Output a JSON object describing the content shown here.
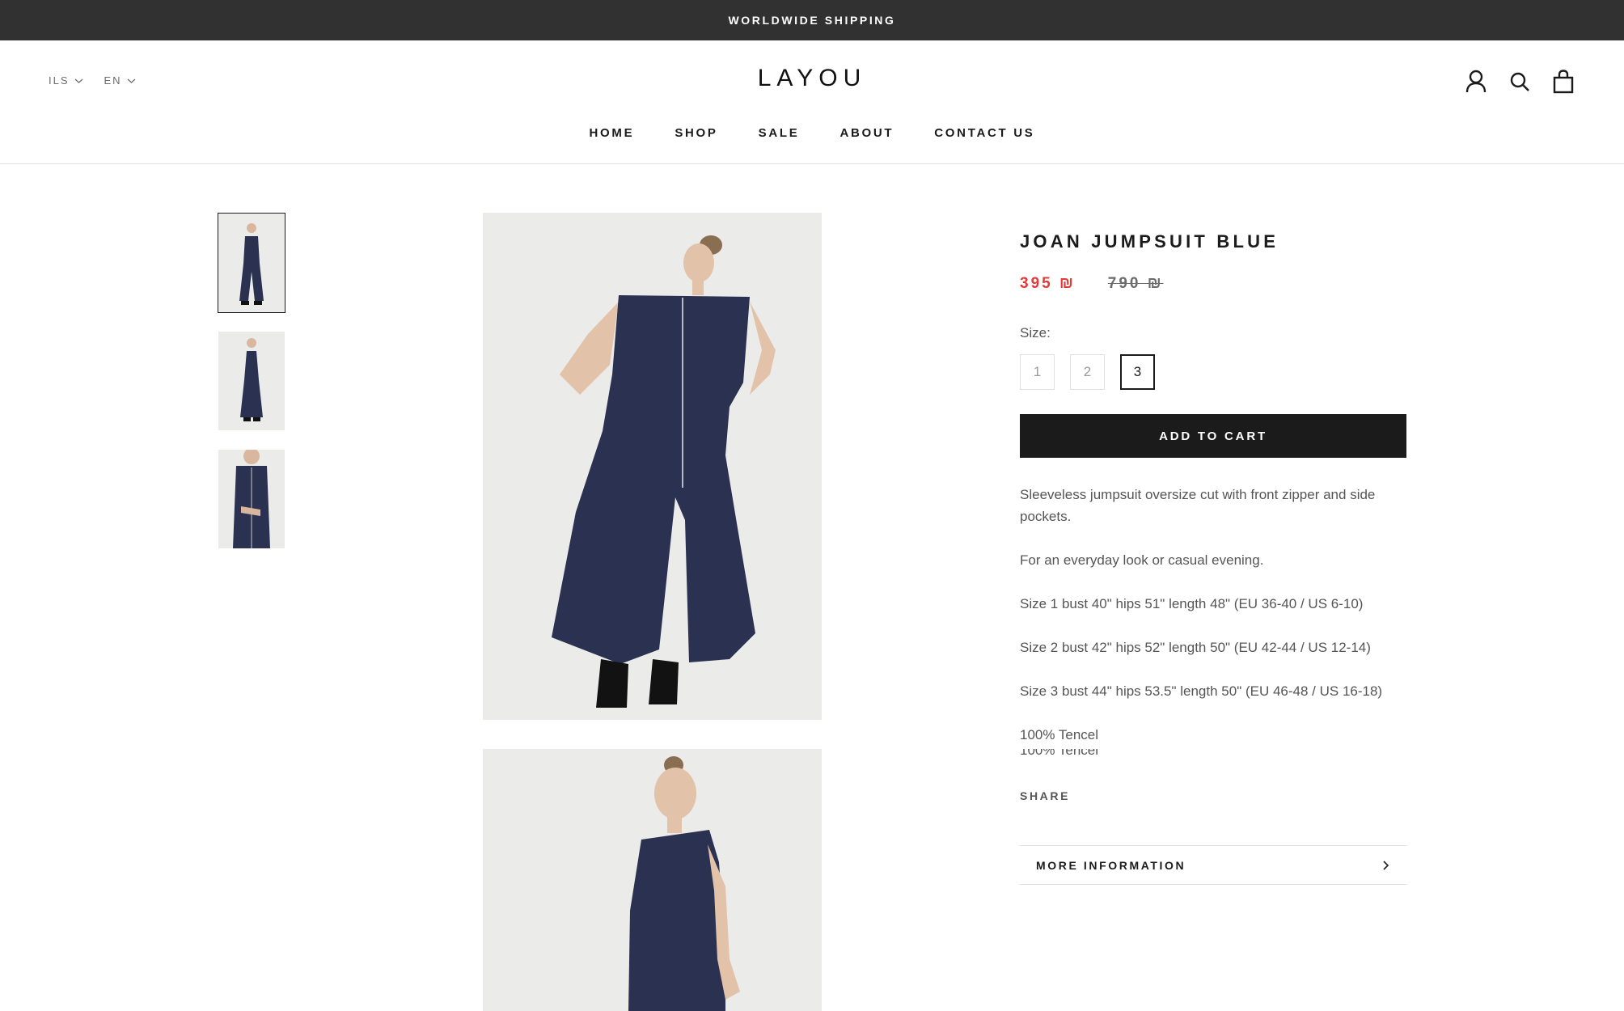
{
  "announcement": "WORLDWIDE SHIPPING",
  "header": {
    "currency": "ILS",
    "language": "EN",
    "logo": "LAYOU",
    "icons": [
      "account-icon",
      "search-icon",
      "cart-icon"
    ]
  },
  "nav": {
    "items": [
      {
        "label": "HOME"
      },
      {
        "label": "SHOP"
      },
      {
        "label": "SALE"
      },
      {
        "label": "ABOUT"
      },
      {
        "label": "CONTACT US"
      }
    ]
  },
  "product": {
    "title": "JOAN JUMPSUIT BLUE",
    "price_sale": "395 ₪",
    "price_original": "790 ₪",
    "size_label": "Size:",
    "sizes": [
      "1",
      "2",
      "3"
    ],
    "selected_size": "3",
    "add_to_cart": "ADD TO CART",
    "description": [
      "Sleeveless jumpsuit oversize cut with front zipper and side pockets.",
      "For an everyday look or casual evening.",
      "Size 1 bust 40\" hips 51\" length 48\" (EU 36-40 / US 6-10)",
      "Size 2 bust 42\" hips 52\" length 50\" (EU 42-44 / US 12-14)",
      "Size 3 bust 44\" hips 53.5\" length 50\" (EU 46-48 / US 16-18)",
      "100% Tencel"
    ],
    "ghost_text": "100% Tencel",
    "share": "SHARE",
    "more_info": "MORE INFORMATION"
  },
  "colors": {
    "announcement_bg": "#313131",
    "sale_price": "#e53935",
    "button_bg": "#1c1b1b",
    "garment": "#2b3150"
  }
}
